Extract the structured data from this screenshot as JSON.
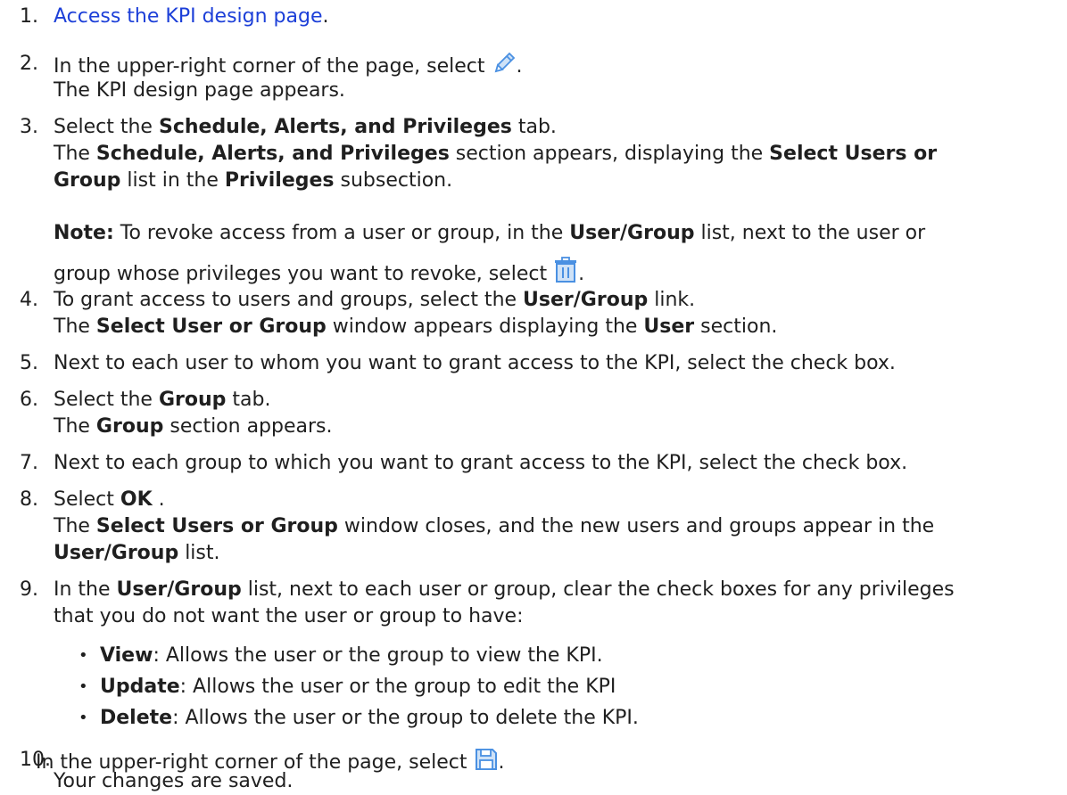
{
  "steps": [
    {
      "num": "1.",
      "link": "Access the KPI design page",
      "after": "."
    },
    {
      "num": "2.",
      "pre": "In the upper-right corner of the page, select",
      "icon": "pencil-icon",
      "post": ".",
      "result": "The KPI design page appears."
    },
    {
      "num": "3.",
      "t1": "Select the ",
      "b1": "Schedule, Alerts, and Privileges",
      "t2": " tab.",
      "r1": "The ",
      "rb1": "Schedule, Alerts, and Privileges",
      "r2": " section appears, displaying the ",
      "rb2": "Select Users or",
      "r3b": "Group",
      "r3": " list in the ",
      "r3b2": "Privileges",
      "r4": " subsection."
    },
    {
      "num": "4.",
      "t1": "To grant access to users and groups, select the ",
      "b1": "User/Group",
      "t2": " link.",
      "r1": "The ",
      "rb1": "Select User or Group",
      "r2": " window appears displaying the ",
      "rb2": "User",
      "r3": " section."
    },
    {
      "num": "5.",
      "text": "Next to each user to whom you want to grant access to the KPI, select the check box."
    },
    {
      "num": "6.",
      "t1": "Select the ",
      "b1": "Group",
      "t2": " tab.",
      "r1": "The ",
      "rb1": "Group",
      "r2": " section appears."
    },
    {
      "num": "7.",
      "text": "Next to each group to which you want to grant access to the KPI, select the check box."
    },
    {
      "num": "8.",
      "t1": "Select ",
      "b1": "OK",
      "t2": " .",
      "r1": "The ",
      "rb1": "Select Users or Group",
      "r2": " window closes, and the new users and groups appear in the",
      "r3b": "User/Group",
      "r3": " list."
    },
    {
      "num": "9.",
      "t1": "In the ",
      "b1": "User/Group",
      "t2": " list, next to each user or group, clear the check boxes for any privileges",
      "t3": "that you do not want the user or group to have:"
    },
    {
      "num": "10.",
      "pre": "In the upper-right corner of the page, select",
      "icon": "save-icon",
      "post": ".",
      "result": "Your changes are saved."
    }
  ],
  "note": {
    "label": "Note:",
    "t1": " To revoke access from a user or group, in the ",
    "b1": "User/Group",
    "t2": " list, next to the user or",
    "t3": "group whose privileges you want to revoke, select",
    "icon": "trash-icon",
    "t4": "."
  },
  "privileges": [
    {
      "name": "View",
      "desc": ": Allows the user or the group to view the KPI."
    },
    {
      "name": "Update",
      "desc": ": Allows the user or the group to edit the KPI"
    },
    {
      "name": "Delete",
      "desc": ": Allows the user or the group to delete the KPI."
    }
  ],
  "colors": {
    "link": "#1c3fd8",
    "icon": "#4a90e2"
  }
}
